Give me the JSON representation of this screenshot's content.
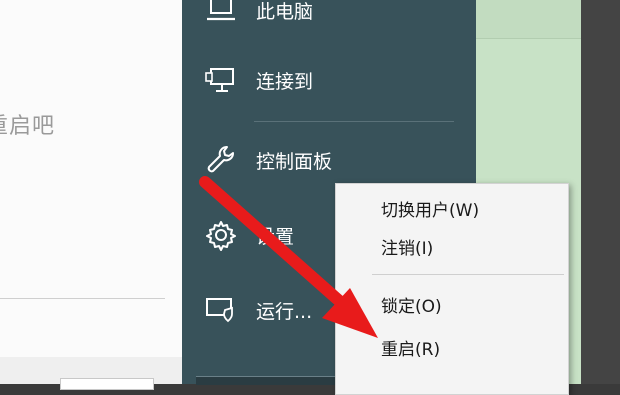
{
  "background_doc": {
    "text": "重启吧"
  },
  "start_menu": {
    "items": [
      {
        "label": "此电脑",
        "icon": "computer-icon"
      },
      {
        "label": "连接到",
        "icon": "monitor-connect-icon"
      },
      {
        "label": "控制面板",
        "icon": "wrench-icon"
      },
      {
        "label": "设置",
        "icon": "gear-icon"
      },
      {
        "label": "运行...",
        "icon": "run-dialog-icon"
      }
    ]
  },
  "context_menu": {
    "items": [
      {
        "label": "切换用户(W)"
      },
      {
        "label": "注销(I)"
      },
      {
        "label": "锁定(O)"
      },
      {
        "label": "重启(R)"
      }
    ]
  },
  "annotation": {
    "arrow_color": "#e81b1b",
    "points_to": "重启(R)"
  },
  "colors": {
    "menu_bg": "#38525a",
    "green_bg": "#c8e2c6",
    "submenu_bg": "#f4f4f4"
  }
}
